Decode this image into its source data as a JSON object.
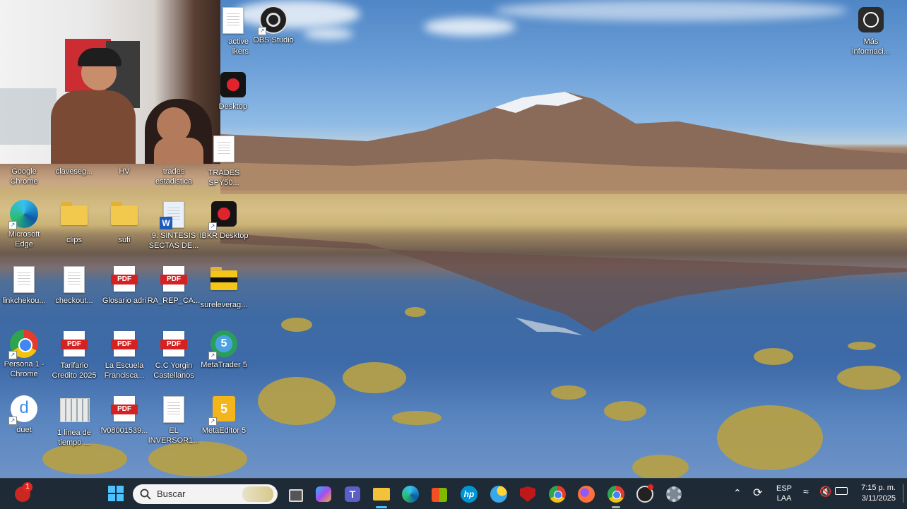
{
  "desktop": {
    "icons": [
      {
        "label": "Google\nChrome",
        "icon": "chrome-icon"
      },
      {
        "label": "claveseguridad",
        "display": "claveseg...",
        "icon": "document-icon"
      },
      {
        "label": "HV",
        "icon": "document-icon"
      },
      {
        "label": "trades\nestadistica",
        "icon": "document-icon"
      },
      {
        "label": "TRADES\nSPY50...",
        "icon": "document-icon"
      },
      {
        "label": "Microsoft\nEdge",
        "icon": "edge-icon"
      },
      {
        "label": "clips",
        "icon": "folder-icon"
      },
      {
        "label": "sufi",
        "icon": "folder-icon"
      },
      {
        "label": "9. SINTESIS\nSECTAS DE...",
        "icon": "word-icon"
      },
      {
        "label": "IBKR Desktop",
        "icon": "ibkr-icon"
      },
      {
        "label": "linkchekou...",
        "icon": "document-icon"
      },
      {
        "label": "checkout...",
        "icon": "document-icon"
      },
      {
        "label": "Glosario adri",
        "icon": "pdf-icon"
      },
      {
        "label": "RA_REP_CA...",
        "icon": "pdf-icon"
      },
      {
        "label": "sureleverag...",
        "icon": "folder-icon"
      },
      {
        "label": "Persona 1 -\nChrome",
        "icon": "chrome-profile-icon"
      },
      {
        "label": "Tarifario\nCredito 2025",
        "icon": "pdf-icon"
      },
      {
        "label": "La Escuela\nFrancisca...",
        "icon": "pdf-icon"
      },
      {
        "label": "C.C Yorgin\nCastellanos",
        "icon": "pdf-icon"
      },
      {
        "label": "MetaTrader 5",
        "icon": "metatrader-icon"
      },
      {
        "label": "duet",
        "icon": "duet-icon"
      },
      {
        "label": "1 linea de\ntiempo ...",
        "icon": "image-icon"
      },
      {
        "label": "fv08001539...",
        "icon": "pdf-icon"
      },
      {
        "label": "EL\nINVERSOR1...",
        "icon": "document-icon"
      },
      {
        "label": "MetaEditor 5",
        "icon": "metaeditor-icon"
      },
      {
        "label": "active\nikers",
        "icon": "document-icon"
      },
      {
        "label": "OBS Studio",
        "icon": "obs-icon"
      },
      {
        "label": "Desktop",
        "icon": "ibkr-icon"
      },
      {
        "label": "Más\ninformaci...",
        "icon": "spotlight-icon"
      }
    ],
    "pdf_badge": "PDF"
  },
  "taskbar": {
    "search_placeholder": "Buscar",
    "notification_count": "1",
    "apps": [
      "start-icon",
      "task-view-icon",
      "copilot-icon",
      "teams-icon",
      "file-explorer-icon",
      "edge-icon",
      "store-icon",
      "hp-icon",
      "weather-icon",
      "mcafee-icon",
      "chrome-icon",
      "firefox-icon",
      "chrome-profile-icon",
      "obs-icon",
      "settings-icon"
    ],
    "tray": {
      "language_line1": "ESP",
      "language_line2": "LAA",
      "time": "7:15 p. m.",
      "date": "3/11/2025"
    }
  },
  "colors": {
    "taskbar_bg": "#1e2a36",
    "accent": "#0078d4",
    "pdf_red": "#d42222"
  }
}
